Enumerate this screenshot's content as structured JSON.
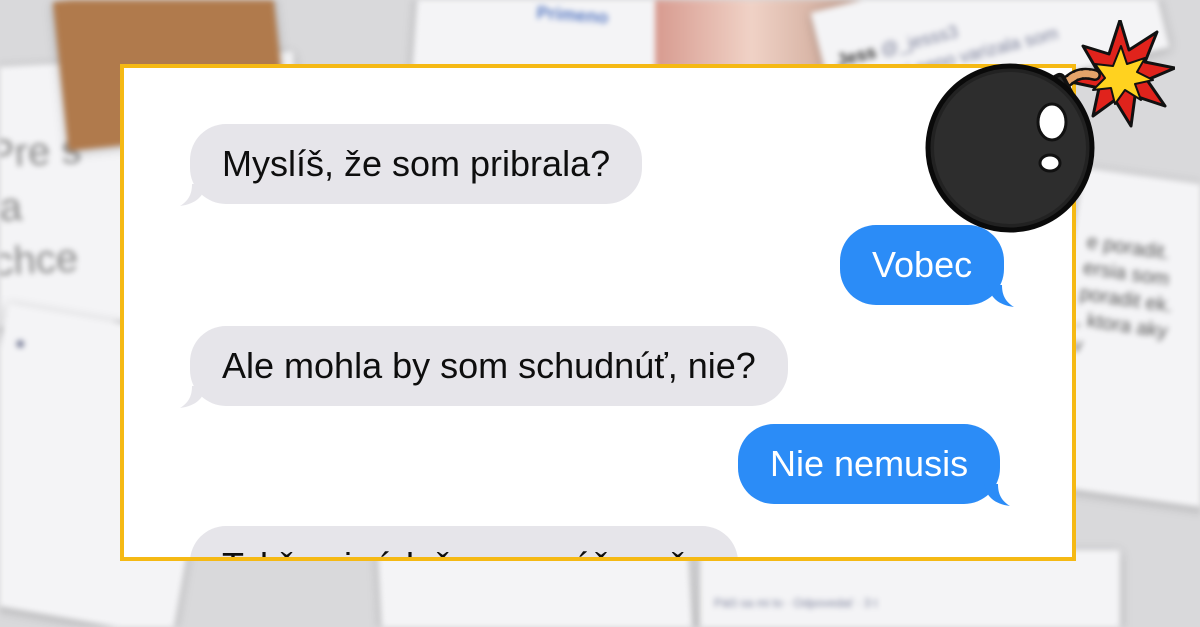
{
  "messages": [
    {
      "dir": "in",
      "text": "Myslíš, že som pribrala?"
    },
    {
      "dir": "out",
      "text": "Vobec"
    },
    {
      "dir": "in",
      "text": "Ale mohla by som schudnúť, nie?"
    },
    {
      "dir": "out",
      "text": "Nie nemusis"
    },
    {
      "dir": "in",
      "text": "Takže si rád, že ma máš za če"
    }
  ],
  "background": {
    "left_post_text": "Pre s ja chce",
    "right_post_text": "e poradit. ersia som poradit ek. , ktora aky v",
    "top_right_user": "Jess",
    "top_right_handle": "@_jesss3",
    "top_right_text": "Vlade mi nepo varizala som",
    "top_card_brand": "Primeno",
    "comment_actions": "Páči sa mi to · Odpovedať · 3 t"
  },
  "colors": {
    "frame": "#f5b914",
    "incoming_bubble": "#e6e5ea",
    "outgoing_bubble": "#2b8cf7"
  },
  "icons": [
    "bomb-icon",
    "explosion-icon"
  ]
}
